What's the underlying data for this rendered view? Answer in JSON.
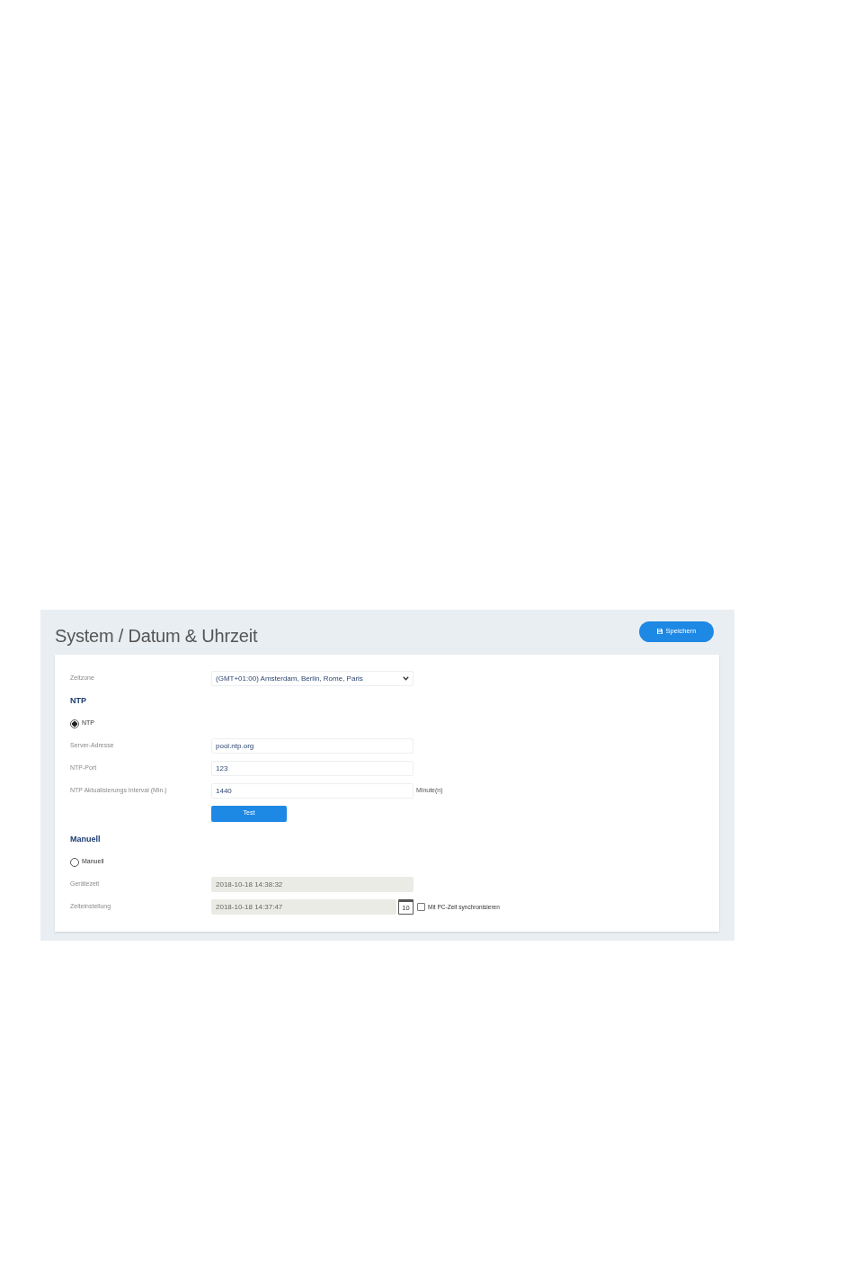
{
  "page": {
    "title": "System / Datum & Uhrzeit",
    "save_button": "Speichern"
  },
  "timezone": {
    "label": "Zeitzone",
    "value": "(GMT+01:00) Amsterdam, Berlin, Rome, Paris"
  },
  "sections": [
    {
      "heading": "NTP",
      "radio": {
        "label": "NTP",
        "selected": true
      },
      "fields": [
        {
          "kind": "text",
          "label": "Server-Adresse",
          "value": "pool.ntp.org",
          "disabled": false
        },
        {
          "kind": "text",
          "label": "NTP-Port",
          "value": "123",
          "disabled": false
        },
        {
          "kind": "text",
          "label": "NTP Aktualisierungs Interval (Min.)",
          "value": "1440",
          "unit": "Minute(n)",
          "disabled": false
        }
      ],
      "button": "Test"
    },
    {
      "heading": "Manuell",
      "radio": {
        "label": "Manuell",
        "selected": false
      },
      "fields": [
        {
          "kind": "text",
          "label": "Gerätezeit",
          "value": "2018-10-18 14:38:32",
          "disabled": true
        },
        {
          "kind": "datetime",
          "label": "Zeiteinstellung",
          "value": "2018-10-18 14:37:47",
          "disabled": true,
          "calendar_day": "10",
          "sync_checkbox": {
            "label": "Mit PC-Zeit synchronisieren",
            "checked": false
          }
        }
      ]
    }
  ]
}
